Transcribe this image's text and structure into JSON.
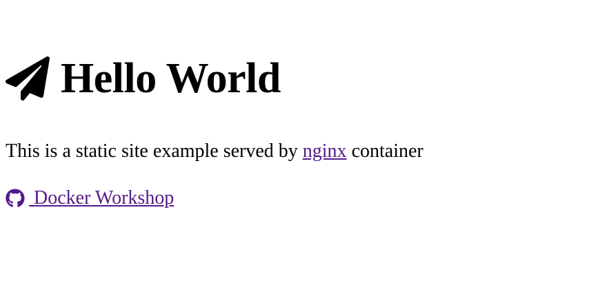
{
  "header": {
    "icon": "paper-plane-icon",
    "title": "Hello World"
  },
  "intro": {
    "text_before": "This is a static site example served by ",
    "link_label": "nginx",
    "text_after": " container"
  },
  "repo": {
    "icon": "github-icon",
    "link_label": " Docker Workshop"
  },
  "colors": {
    "text": "#000000",
    "link_visited": "#551a8b",
    "background": "#ffffff"
  }
}
